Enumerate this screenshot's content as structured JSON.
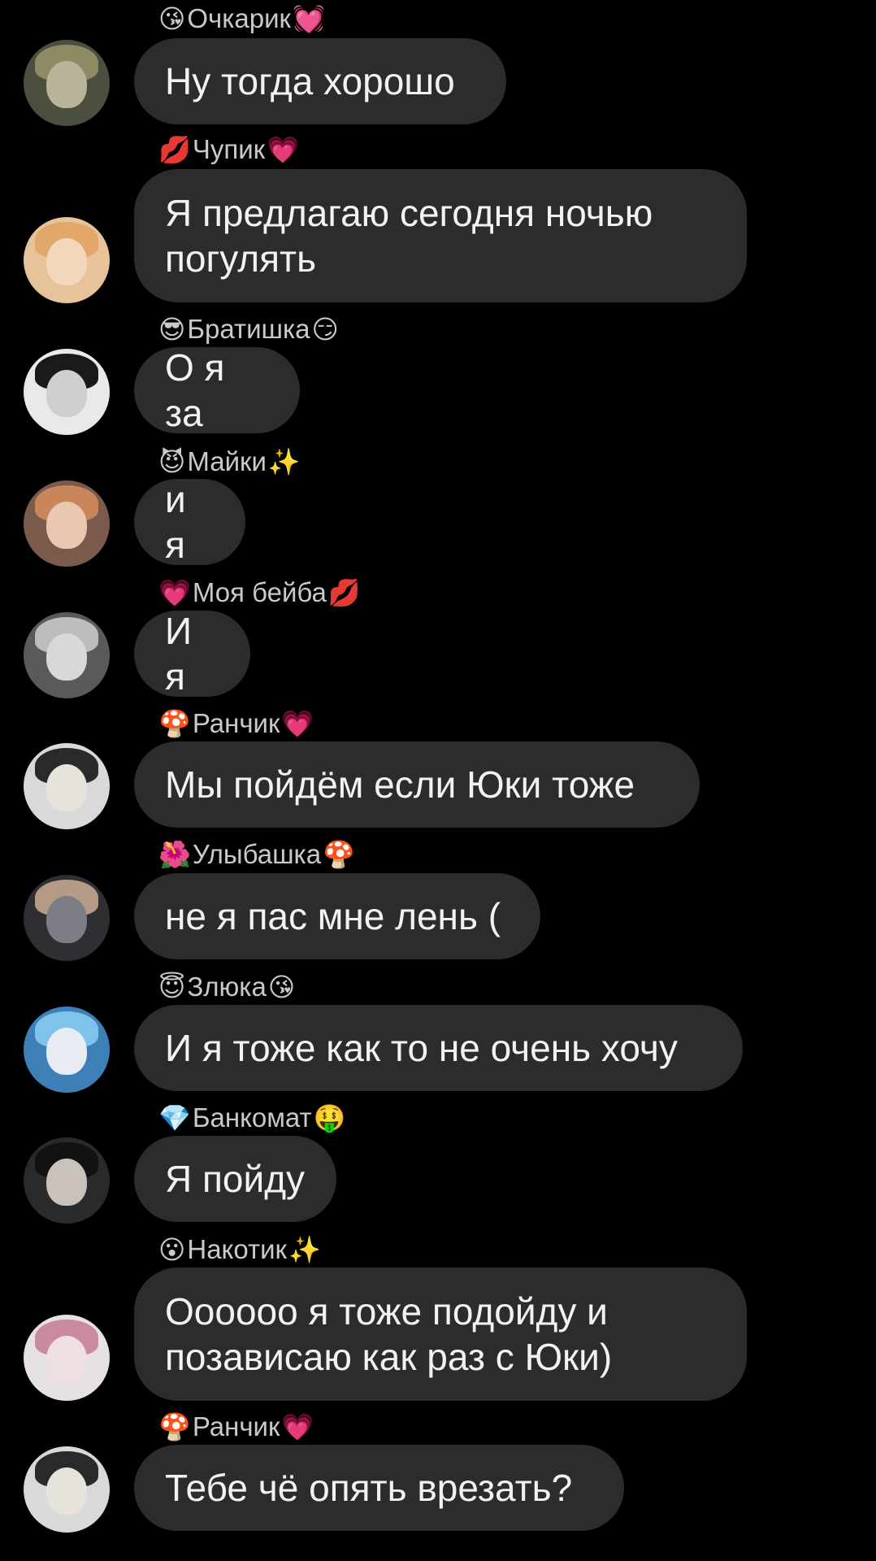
{
  "messages": [
    {
      "sender": "Очкарик",
      "emoji_left": "😘",
      "emoji_right": "💓",
      "text": "Ну тогда хорошо",
      "avatar": {
        "bg": "#4a4f3e",
        "face": "#b8b49a",
        "hair": "#8d8a64"
      }
    },
    {
      "sender": "Чупик",
      "emoji_left": "💋",
      "emoji_right": "💗",
      "text": "Я предлагаю сегодня ночью погулять",
      "avatar": {
        "bg": "#e8c39a",
        "face": "#f3d7bc",
        "hair": "#e2a86a"
      }
    },
    {
      "sender": "Братишка",
      "emoji_left": "😎",
      "emoji_right": "😏",
      "text": "О я за",
      "avatar": {
        "bg": "#e9e9e9",
        "face": "#cfcfcf",
        "hair": "#1a1a1a"
      }
    },
    {
      "sender": "Майки",
      "emoji_left": "😈",
      "emoji_right": "✨",
      "text": "и я",
      "avatar": {
        "bg": "#7a5a4a",
        "face": "#e9c7b0",
        "hair": "#c9865a"
      }
    },
    {
      "sender": "Моя бейба",
      "emoji_left": "💗",
      "emoji_right": "💋",
      "text": "И я",
      "avatar": {
        "bg": "#5a5a5a",
        "face": "#d8d8d8",
        "hair": "#bdbdbd"
      }
    },
    {
      "sender": "Ранчик",
      "emoji_left": "🍄",
      "emoji_right": "💗",
      "text": "Мы пойдём если Юки тоже",
      "avatar": {
        "bg": "#d9d9d9",
        "face": "#e8e2dc",
        "hair": "#2a2a2a"
      }
    },
    {
      "sender": "Улыбашка",
      "emoji_left": "🌺",
      "emoji_right": "🍄",
      "text": "не я пас мне лень (",
      "avatar": {
        "bg": "#2e2e33",
        "face": "#7d7d86",
        "hair": "#b59b86"
      }
    },
    {
      "sender": "Злюка",
      "emoji_left": "😇",
      "emoji_right": "😘",
      "text": "И я тоже как то не очень хочу",
      "avatar": {
        "bg": "#3f7fb8",
        "face": "#e6ecf2",
        "hair": "#7fc3ea"
      }
    },
    {
      "sender": "Банкомат",
      "emoji_left": "💎",
      "emoji_right": "🤑",
      "text": "Я пойду",
      "avatar": {
        "bg": "#2a2a2a",
        "face": "#c9c2bb",
        "hair": "#121212"
      }
    },
    {
      "sender": "Накотик",
      "emoji_left": "😮",
      "emoji_right": "✨",
      "text": "Оооооо я тоже подойду и позависаю как раз с Юки)",
      "avatar": {
        "bg": "#e6e1e5",
        "face": "#f0dfe0",
        "hair": "#c98aa0"
      }
    },
    {
      "sender": "Ранчик",
      "emoji_left": "🍄",
      "emoji_right": "💗",
      "text": "Тебе чё опять врезать?",
      "avatar": {
        "bg": "#d9d9d9",
        "face": "#e8e2dc",
        "hair": "#2a2a2a"
      }
    }
  ]
}
